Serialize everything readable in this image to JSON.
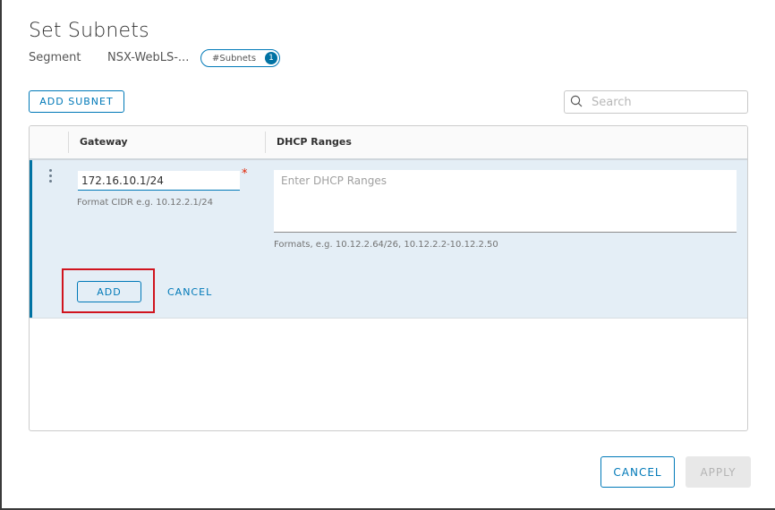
{
  "dialog": {
    "title": "Set Subnets",
    "segment_label": "Segment",
    "segment_value": "NSX-WebLS-...",
    "subnets_pill_label": "#Subnets",
    "subnets_count": "1"
  },
  "toolbar": {
    "add_subnet_label": "ADD SUBNET",
    "search_placeholder": "Search",
    "search_value": ""
  },
  "grid": {
    "columns": [
      "Gateway",
      "DHCP Ranges"
    ],
    "edit_row": {
      "gateway_value": "172.16.10.1/24",
      "gateway_required_marker": "*",
      "gateway_help": "Format CIDR e.g. 10.12.2.1/24",
      "dhcp_placeholder": "Enter DHCP Ranges",
      "dhcp_value": "",
      "dhcp_help": "Formats, e.g. 10.12.2.64/26, 10.12.2.2-10.12.2.50",
      "add_label": "ADD",
      "cancel_label": "CANCEL"
    }
  },
  "footer": {
    "cancel_label": "CANCEL",
    "apply_label": "APPLY"
  },
  "colors": {
    "accent": "#0079b8",
    "highlight": "#d0141e",
    "required": "#e12200",
    "edit_row_bg": "#e4eef6"
  }
}
